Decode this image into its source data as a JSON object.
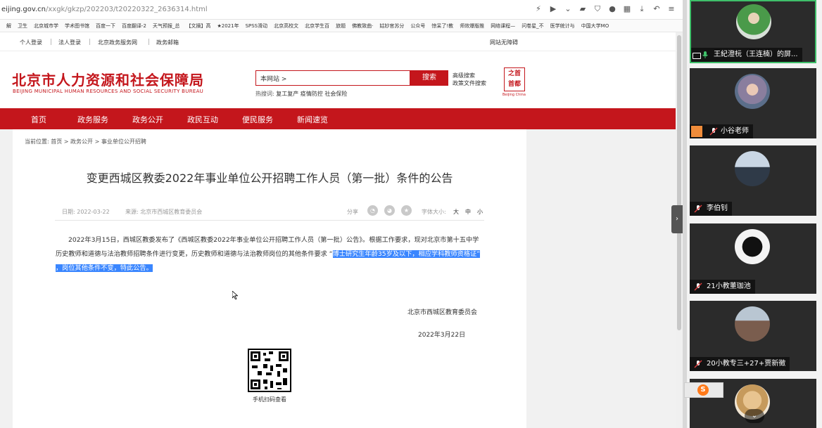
{
  "browser": {
    "url_prefix": "eijing.gov.cn",
    "url_path": "/xxgk/gkzp/202203/t20220322_2636314.html",
    "bookmarks": [
      "解",
      "卫生",
      "北京城市学",
      "学术图书馆",
      "百度一下",
      "百度翻译-2",
      "天气预报_总",
      "【文摘】高",
      "★2021年",
      "SPSS滑动",
      "北京高校文",
      "北京学生百",
      "旅题",
      "佛教致曲·",
      "姑妙官苏分",
      "公众号",
      "惊呆了!教",
      "师效爆版推",
      "网络课程—",
      "问卷星_不",
      "医学统计与",
      "中国大学MO"
    ]
  },
  "site": {
    "top_links": [
      "个人登录",
      "法人登录",
      "北京政务服务网",
      "政务邮箱"
    ],
    "accessibility": "网站无障碍",
    "logo_cn": "北京市人力资源和社会保障局",
    "logo_en": "BEIJING MUNICIPAL HUMAN RESOURCES AND SOCIAL SECURITY BUREAU",
    "search_scope": "本网站 >",
    "search_button": "搜索",
    "advanced_search": "高级搜索",
    "policy_search": "政策文件搜索",
    "hot_words_label": "热搜词:",
    "hot_words": "复工复产  疫情防控  社会保险",
    "capital_logo_line1": "之首",
    "capital_logo_line2": "首都",
    "capital_logo_en": "Beijing China",
    "nav": [
      "首页",
      "政务服务",
      "政务公开",
      "政民互动",
      "便民服务",
      "新闻速览"
    ]
  },
  "article": {
    "breadcrumb": "当前位置: 首页 > 政务公开 > 事业单位公开招聘",
    "title": "变更西城区教委2022年事业单位公开招聘工作人员（第一批）条件的公告",
    "date": "日期: 2022-03-22",
    "source": "来源: 北京市西城区教育委员会",
    "share_label": "分享",
    "font_label": "字体大小:",
    "font_sizes": [
      "大",
      "中",
      "小"
    ],
    "body_plain": "2022年3月15日，西城区教委发布了《西城区教委2022年事业单位公开招聘工作人员（第一批）公告》。根据工作要求，现对北京市第十五中学历史教师和道德与法治教师招聘条件进行变更，历史教师和道德与法治教师岗位的其他条件要求 “",
    "body_highlight": "博士研究生年龄35岁及以下，相应学科教师资格证” ，岗位其他条件不变，特此公告。",
    "signer": "北京市西城区教育委员会",
    "sign_date": "2022年3月22日",
    "qr_caption": "手机扫码查看"
  },
  "meeting": {
    "participants": [
      {
        "name": "王紀澄杬（王连楠）的屏...",
        "active": true
      },
      {
        "name": "小谷老师",
        "active": false
      },
      {
        "name": "李伯钊",
        "active": false
      },
      {
        "name": "21小教董珈池",
        "active": false
      },
      {
        "name": "20小教专三+27+贾新徵",
        "active": false
      },
      {
        "name": "",
        "active": false
      }
    ],
    "accent": "#3fbf6a"
  }
}
